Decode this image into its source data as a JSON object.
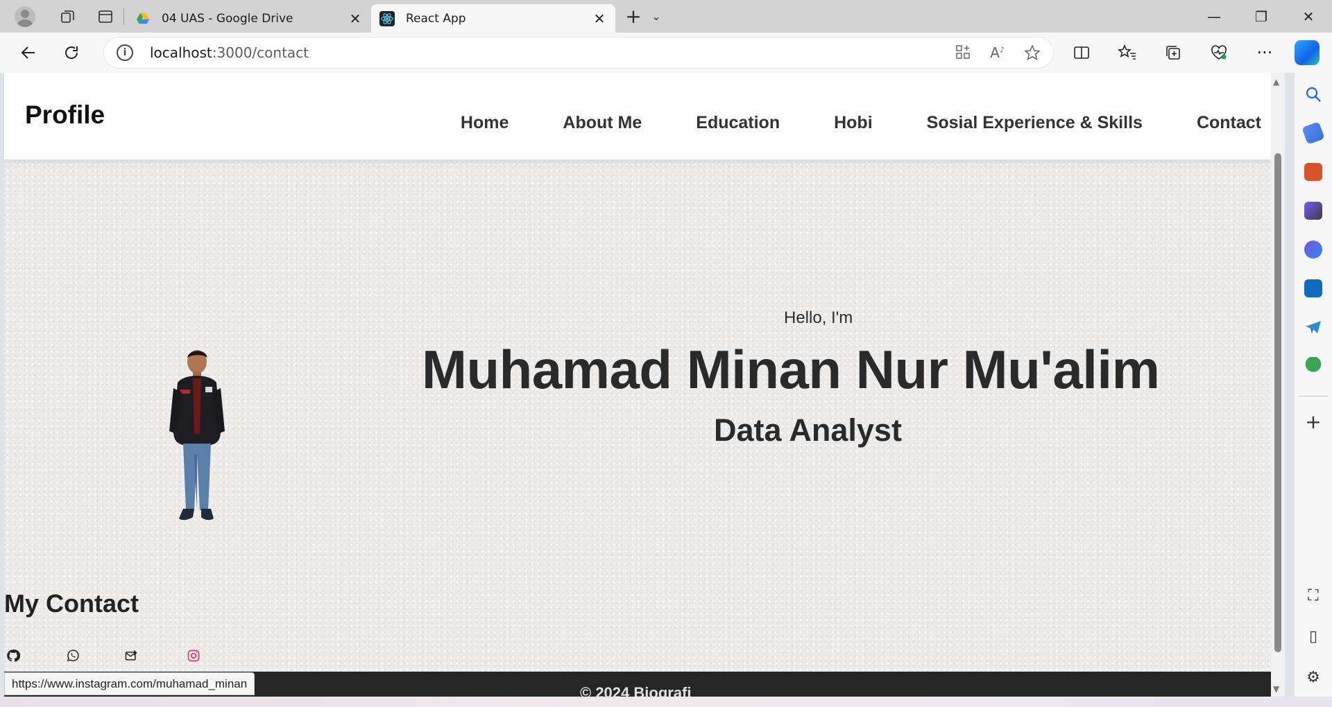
{
  "browser": {
    "tabs": [
      {
        "title": "04 UAS - Google Drive",
        "active": false,
        "favicon": "google-drive-icon"
      },
      {
        "title": "React App",
        "active": true,
        "favicon": "react-icon"
      }
    ],
    "url_host": "localhost",
    "url_path": ":3000/contact",
    "status_url": "https://www.instagram.com/muhamad_minan"
  },
  "site": {
    "brand": "Profile",
    "nav": [
      "Home",
      "About Me",
      "Education",
      "Hobi",
      "Sosial Experience & Skills",
      "Contact"
    ],
    "hero": {
      "greeting": "Hello, I'm",
      "name": "Muhamad Minan Nur Mu'alim",
      "role": "Data Analyst"
    },
    "contact_heading": "My Contact",
    "contact_icons": [
      "github-icon",
      "whatsapp-icon",
      "email-icon",
      "instagram-icon"
    ],
    "footer": "© 2024 Biografi"
  },
  "colors": {
    "nav_bg": "#ffffff",
    "page_bg": "#ecebea",
    "footer_bg": "#262626",
    "instagram": "#e1306c",
    "text_dark": "#2a2a2a"
  }
}
